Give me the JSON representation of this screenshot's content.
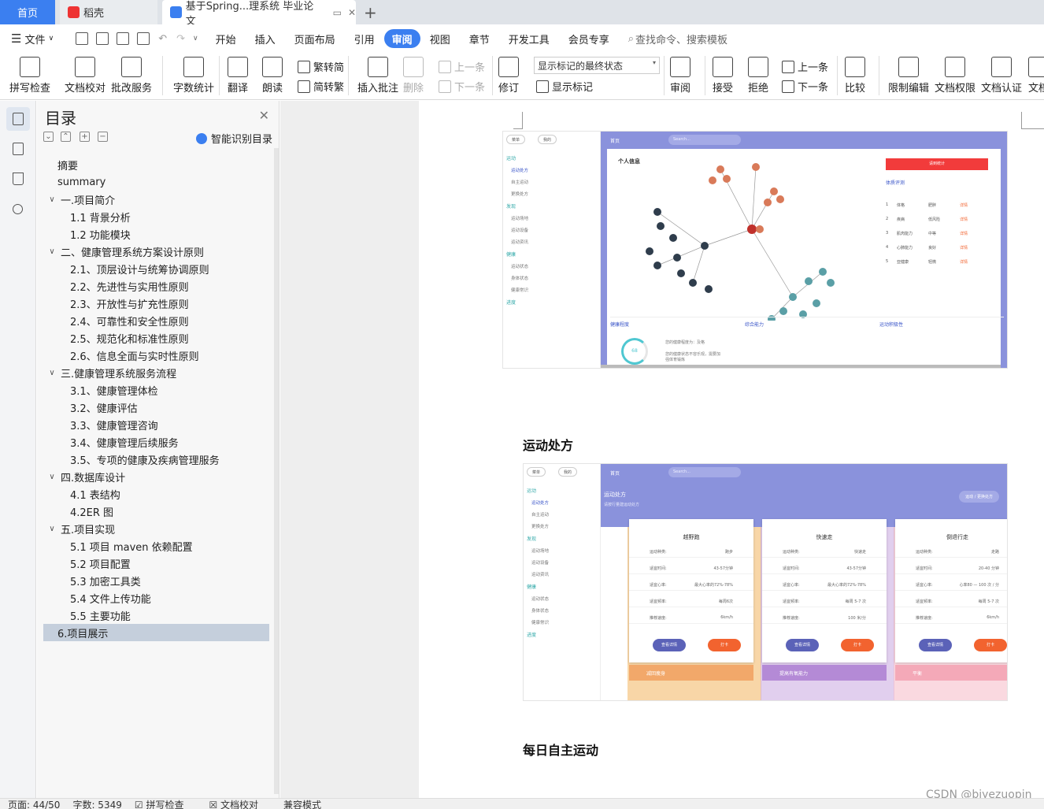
{
  "tabs": {
    "home": "首页",
    "daoke": "稻壳",
    "doc": "基于Spring...理系统 毕业论文",
    "new_tab": "+"
  },
  "menu": {
    "file": "文件",
    "items": [
      "开始",
      "插入",
      "页面布局",
      "引用",
      "审阅",
      "视图",
      "章节",
      "开发工具",
      "会员专享"
    ],
    "active": "审阅",
    "search": "查找命令、搜索模板"
  },
  "ribbon": {
    "spell_check": "拼写检查",
    "doc_proof": "文档校对",
    "batch_service": "批改服务",
    "word_count": "字数统计",
    "translate": "翻译",
    "read_aloud": "朗读",
    "trad": "繁转简",
    "simp": "简转繁",
    "insert_comment": "插入批注",
    "delete": "删除",
    "prev_comment": "上一条",
    "next_comment": "下一条",
    "revise": "修订",
    "markup_state": "显示标记的最终状态",
    "show_markup": "显示标记",
    "review": "审阅",
    "accept": "接受",
    "reject": "拒绝",
    "prev": "上一条",
    "next": "下一条",
    "compare": "比较",
    "restrict_edit": "限制编辑",
    "doc_rights": "文档权限",
    "doc_auth": "文档认证",
    "doc_more": "文档"
  },
  "toc": {
    "title": "目录",
    "smart": "智能识别目录",
    "items": [
      {
        "label": "摘要",
        "level": 1,
        "caret": ""
      },
      {
        "label": "summary",
        "level": 1,
        "caret": ""
      },
      {
        "label": "一.项目简介",
        "level": 0,
        "caret": "∨"
      },
      {
        "label": "1.1 背景分析",
        "level": 2,
        "caret": ""
      },
      {
        "label": "1.2 功能模块",
        "level": 2,
        "caret": ""
      },
      {
        "label": "二、健康管理系统方案设计原则",
        "level": 0,
        "caret": "∨"
      },
      {
        "label": "2.1、顶层设计与统筹协调原则",
        "level": 2,
        "caret": ""
      },
      {
        "label": "2.2、先进性与实用性原则",
        "level": 2,
        "caret": ""
      },
      {
        "label": "2.3、开放性与扩充性原则",
        "level": 2,
        "caret": ""
      },
      {
        "label": "2.4、可靠性和安全性原则",
        "level": 2,
        "caret": ""
      },
      {
        "label": "2.5、规范化和标准性原则",
        "level": 2,
        "caret": ""
      },
      {
        "label": "2.6、信息全面与实时性原则",
        "level": 2,
        "caret": ""
      },
      {
        "label": "三.健康管理系统服务流程",
        "level": 0,
        "caret": "∨"
      },
      {
        "label": "3.1、健康管理体检",
        "level": 2,
        "caret": ""
      },
      {
        "label": "3.2、健康评估",
        "level": 2,
        "caret": ""
      },
      {
        "label": "3.3、健康管理咨询",
        "level": 2,
        "caret": ""
      },
      {
        "label": "3.4、健康管理后续服务",
        "level": 2,
        "caret": ""
      },
      {
        "label": "3.5、专项的健康及疾病管理服务",
        "level": 2,
        "caret": ""
      },
      {
        "label": "四.数据库设计",
        "level": 0,
        "caret": "∨"
      },
      {
        "label": "4.1 表结构",
        "level": 2,
        "caret": ""
      },
      {
        "label": "4.2ER 图",
        "level": 2,
        "caret": ""
      },
      {
        "label": "五.项目实现",
        "level": 0,
        "caret": "∨"
      },
      {
        "label": "5.1 项目 maven 依赖配置",
        "level": 2,
        "caret": ""
      },
      {
        "label": "5.2 项目配置",
        "level": 2,
        "caret": ""
      },
      {
        "label": "5.3 加密工具类",
        "level": 2,
        "caret": ""
      },
      {
        "label": "5.4 文件上传功能",
        "level": 2,
        "caret": ""
      },
      {
        "label": "5.5 主要功能",
        "level": 2,
        "caret": ""
      },
      {
        "label": "6.项目展示",
        "level": 1,
        "caret": "",
        "selected": true
      }
    ]
  },
  "doc": {
    "heading1": "运动处方",
    "heading2": "每日自主运动",
    "shot1": {
      "top_home": "首页",
      "search": "Search...",
      "pill1": "菜单",
      "pill2": "我的",
      "panel_title": "个人信息",
      "red_button": "请到统计",
      "eval_title": "体质评测",
      "eval_rows": [
        {
          "n": "1",
          "item": "体格",
          "val": "肥胖",
          "act": "详情"
        },
        {
          "n": "2",
          "item": "疾病",
          "val": "低风险",
          "act": "详情"
        },
        {
          "n": "3",
          "item": "肌肉能力",
          "val": "中等",
          "act": "详情"
        },
        {
          "n": "4",
          "item": "心肺能力",
          "val": "良好",
          "act": "详情"
        },
        {
          "n": "5",
          "item": "亚健康",
          "val": "轻微",
          "act": "详情"
        }
      ],
      "health_title": "健康程度",
      "health_score": "68",
      "health_text1": "您的健康程度为：及格",
      "health_text2": "您的健康状态不容乐观，需要加强体育锻炼",
      "ability_title": "综合能力",
      "activity_title": "运动积极性",
      "side": [
        "运动",
        "运动处方",
        "自主运动",
        "更换处方",
        "发现",
        "运动场地",
        "运动设备",
        "运动资讯",
        "健康",
        "运动状态",
        "身体状态",
        "健康常识",
        "进度"
      ]
    },
    "shot2": {
      "top_home": "首页",
      "search": "Search...",
      "banner_title": "运动处方",
      "banner_sub": "请按行量建运动处方",
      "crumb": "运动 / 更换处方",
      "cards": [
        {
          "title": "越野跑",
          "rows": [
            [
              "运动种类:",
              "跑步"
            ],
            [
              "适宜时间:",
              "43-57分钟"
            ],
            [
              "适宜心率:",
              "最大心率的72%-78%"
            ],
            [
              "适宜频率:",
              "每周6次"
            ],
            [
              "推荐速度:",
              "6km/h"
            ]
          ],
          "btn1": "查看详情",
          "btn2": "打卡",
          "band": "减回瘦身",
          "band_color": "#f2a86a"
        },
        {
          "title": "快速走",
          "rows": [
            [
              "运动种类:",
              "快速走"
            ],
            [
              "适宜时间:",
              "43-57分钟"
            ],
            [
              "适宜心率:",
              "最大心率的72%-78%"
            ],
            [
              "适宜频率:",
              "每周 5-7 次"
            ],
            [
              "推荐速度:",
              "100 米/分"
            ]
          ],
          "btn1": "查看详情",
          "btn2": "打卡",
          "band": "提高有氧能力",
          "band_color": "#b48ad6"
        },
        {
          "title": "倒退行走",
          "rows": [
            [
              "运动种类:",
              "走路"
            ],
            [
              "适宜时间:",
              "20-40 分钟"
            ],
            [
              "适宜心率:",
              "心率80 — 100 次 / 分"
            ],
            [
              "适宜频率:",
              "每周 5-7 次"
            ],
            [
              "推荐速度:",
              "6km/h"
            ]
          ],
          "btn1": "查看详情",
          "btn2": "打卡",
          "band": "平衡",
          "band_color": "#f4a9b8"
        }
      ],
      "side": [
        "运动",
        "运动处方",
        "自主运动",
        "更换处方",
        "发现",
        "运动场地",
        "运动设备",
        "运动资讯",
        "健康",
        "运动状态",
        "身体状态",
        "健康常识",
        "进度"
      ]
    }
  },
  "status": {
    "page": "页面: 44/50",
    "words": "字数: 5349",
    "spell": "拼写检查",
    "proof": "文档校对",
    "compat": "兼容模式"
  },
  "watermark": "CSDN @biyezuopin",
  "colors": {
    "accent": "#3b7ff0",
    "shot_header": "#8a92dc",
    "red": "#f23b3b",
    "orange": "#f2632f"
  }
}
